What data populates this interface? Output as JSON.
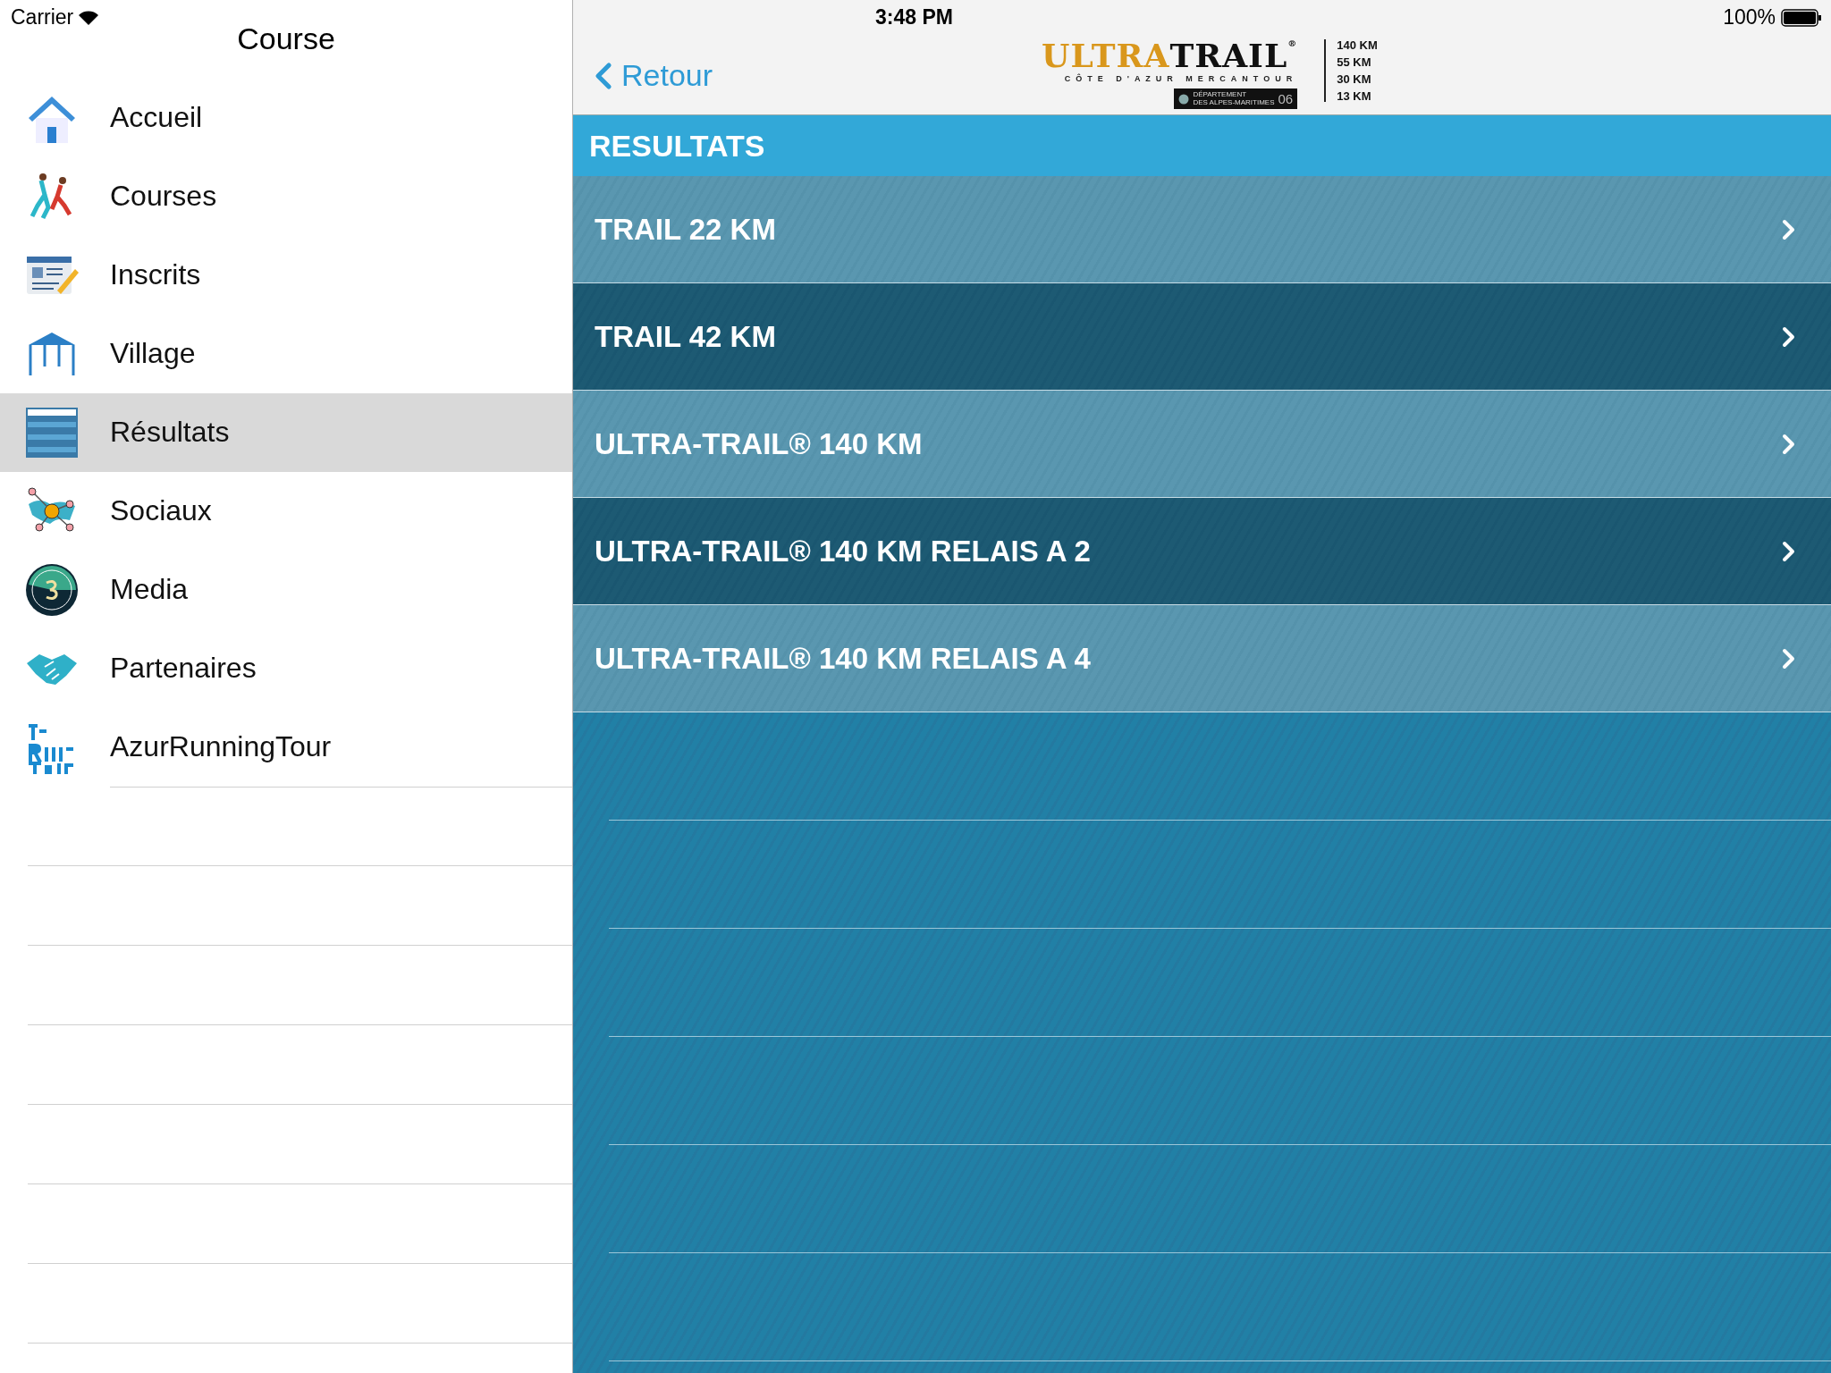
{
  "status_bar": {
    "carrier": "Carrier",
    "time": "3:48 PM",
    "battery": "100%"
  },
  "sidebar": {
    "title": "Course",
    "items": [
      {
        "label": "Accueil",
        "selected": false
      },
      {
        "label": "Courses",
        "selected": false
      },
      {
        "label": "Inscrits",
        "selected": false
      },
      {
        "label": "Village",
        "selected": false
      },
      {
        "label": "Résultats",
        "selected": true
      },
      {
        "label": "Sociaux",
        "selected": false
      },
      {
        "label": "Media",
        "selected": false
      },
      {
        "label": "Partenaires",
        "selected": false
      },
      {
        "label": "AzurRunningTour",
        "selected": false
      }
    ]
  },
  "nav_bar": {
    "back": "Retour",
    "logo": {
      "word_1": "ULTRA",
      "word_2": "TRAIL",
      "mark": "®",
      "subtitle": "CÔTE D'AZUR MERCANTOUR",
      "badge_1": "DÉPARTEMENT",
      "badge_2": "DES ALPES-MARITIMES",
      "badge_number": "06",
      "distances": [
        "140 KM",
        "55 KM",
        "30 KM",
        "13 KM"
      ]
    }
  },
  "section_title": "RESULTATS",
  "races": [
    {
      "label": "TRAIL 22 KM"
    },
    {
      "label": "TRAIL 42 KM"
    },
    {
      "label": "ULTRA-TRAIL® 140 KM"
    },
    {
      "label": "ULTRA-TRAIL® 140 KM RELAIS A 2"
    },
    {
      "label": "ULTRA-TRAIL® 140 KM RELAIS A 4"
    }
  ]
}
